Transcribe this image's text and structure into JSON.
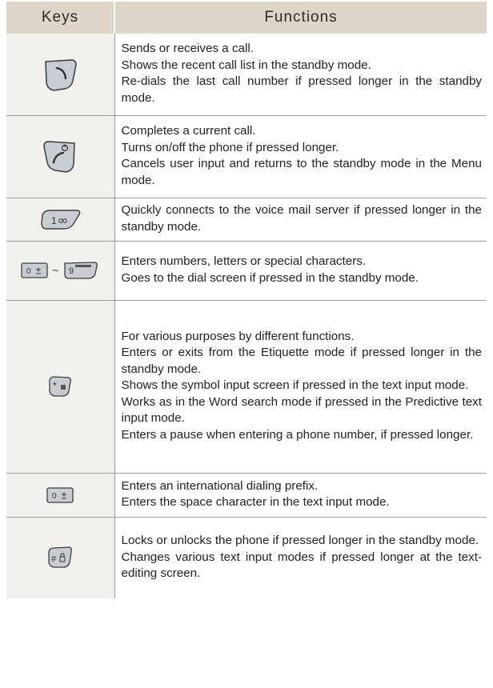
{
  "table": {
    "headers": [
      "Keys",
      "Functions"
    ],
    "rows": [
      {
        "key_icons": [
          "send-key-icon"
        ],
        "lines": [
          "Sends or receives a call.",
          "Shows the recent call list in the standby mode.",
          "Re-dials the last call number if pressed longer in the standby mode."
        ]
      },
      {
        "key_icons": [
          "end-power-key-icon"
        ],
        "lines": [
          "Completes a current call.",
          "Turns on/off the phone if pressed longer.",
          "Cancels user input and returns to the standby mode in the Menu mode."
        ]
      },
      {
        "key_icons": [
          "voicemail-1-key-icon"
        ],
        "key_labels": [
          "1"
        ],
        "lines": [
          "Quickly connects to the voice mail server if pressed longer in the standby mode."
        ]
      },
      {
        "key_icons": [
          "0-key-icon",
          "9-key-icon"
        ],
        "key_labels": [
          "0",
          "9"
        ],
        "separator": "~",
        "lines": [
          "Enters numbers, letters or special characters.",
          "Goes to the dial screen if pressed in the standby mode."
        ]
      },
      {
        "key_icons": [
          "star-key-icon"
        ],
        "key_labels": [
          "*"
        ],
        "lines": [
          "For various purposes by different functions.",
          "Enters or exits from the Etiquette mode if pressed longer in the standby mode.",
          "Shows the symbol input screen if pressed in the text input mode.",
          "Works as in the Word search mode if pressed in the Predictive text input mode.",
          "Enters a pause when entering a phone number, if pressed longer."
        ]
      },
      {
        "key_icons": [
          "0-key-icon"
        ],
        "key_labels": [
          "0"
        ],
        "lines": [
          "Enters an international dialing prefix.",
          "Enters the space character in the text input mode."
        ]
      },
      {
        "key_icons": [
          "hash-key-icon"
        ],
        "key_labels": [
          "#"
        ],
        "lines": [
          "Locks or unlocks the phone if pressed longer in the standby mode.",
          "Changes various text input modes if pressed longer at the text-editing screen."
        ]
      }
    ]
  }
}
